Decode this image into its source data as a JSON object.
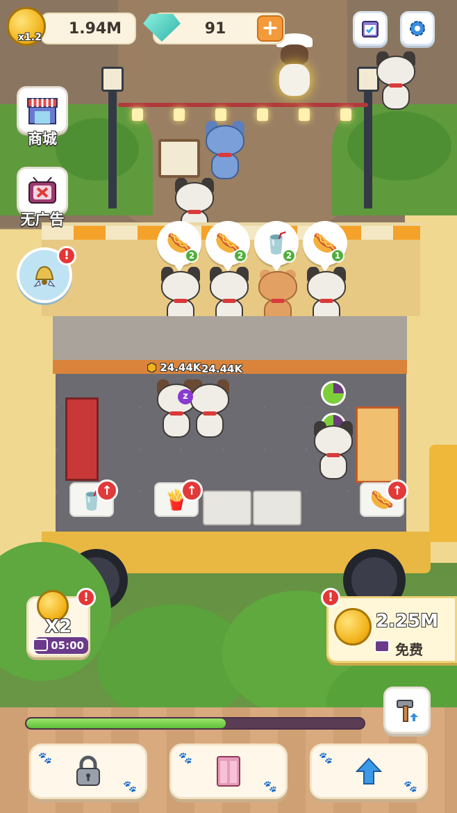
{
  "hud": {
    "coins": "1.94M",
    "coin_multiplier": "x1.2",
    "gems": "91",
    "add_gems_label": "+"
  },
  "side_menu": {
    "shop_label": "商城",
    "no_ads_label": "无广告",
    "alert_mark": "!"
  },
  "orders": [
    {
      "item": "hotdog",
      "count": "2"
    },
    {
      "item": "hotdog",
      "count": "2"
    },
    {
      "item": "soda",
      "count": "2"
    },
    {
      "item": "hotdog",
      "count": "1"
    }
  ],
  "kitchen": {
    "earned_1": "24.44K",
    "earned_2": "24.44K",
    "stations": [
      "soda",
      "fries",
      "fryer",
      "fryer",
      "hotdog"
    ]
  },
  "boost": {
    "label": "X2",
    "timer": "05:00"
  },
  "offer": {
    "amount": "2.25M",
    "free_label": "免费"
  },
  "progress": {
    "value": 0.59
  },
  "colors": {
    "progress_fill": "#5fbf3a",
    "progress_track": "#5a3d55",
    "alert_red": "#e53636",
    "coin_gold": "#f2b31a",
    "gem_teal": "#2fb4a8"
  },
  "icons": {
    "coin": "coin-icon",
    "gem": "gem-icon",
    "calendar": "calendar-icon",
    "settings": "gear-icon",
    "shop": "shop-icon",
    "no_ads": "tv-no-ads-icon",
    "bell": "bell-icon",
    "hammer": "hammer-icon",
    "lock": "lock-icon",
    "door": "door-icon",
    "upgrade": "arrow-up-icon"
  }
}
